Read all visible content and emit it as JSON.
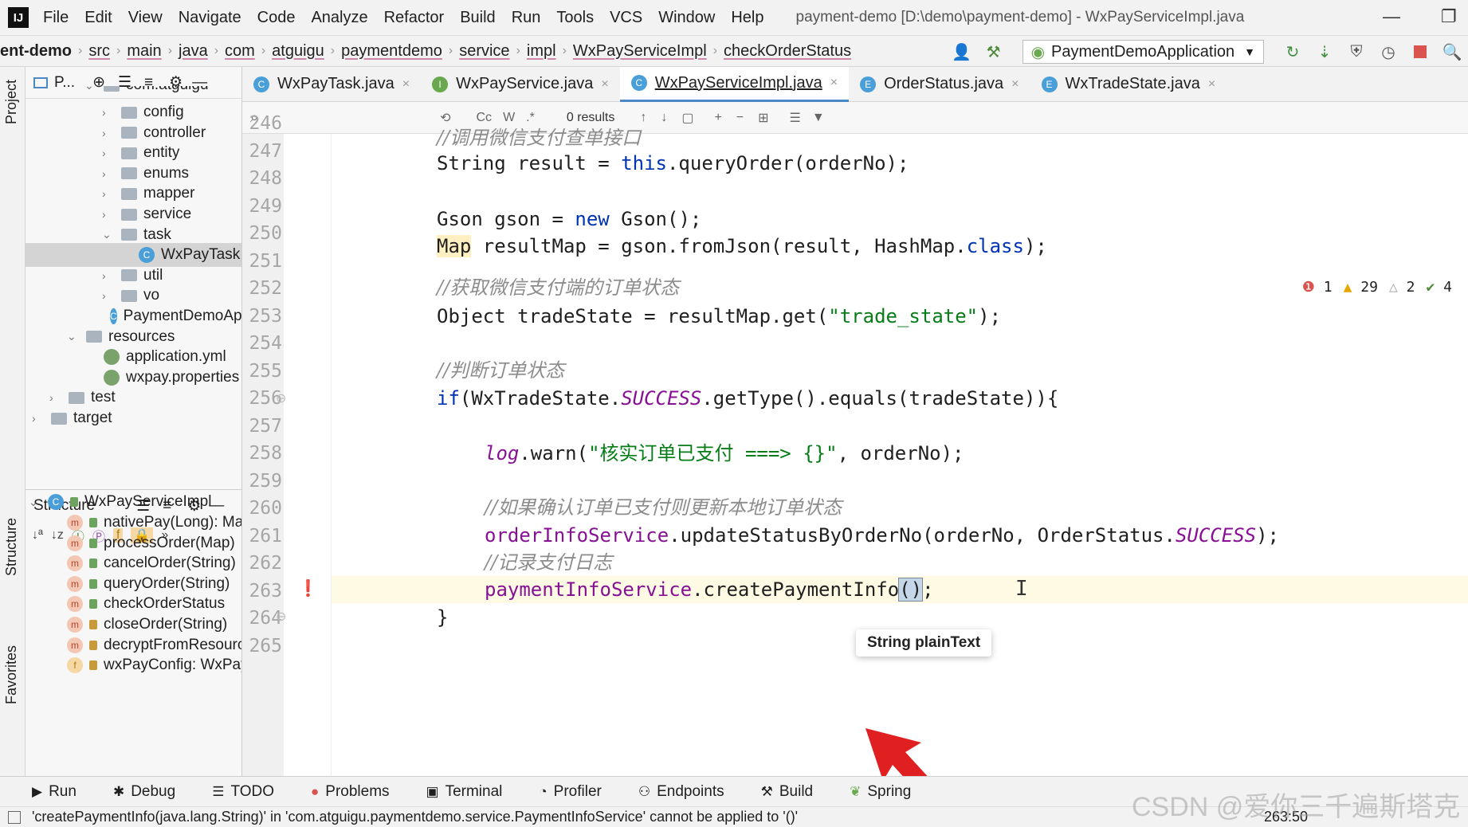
{
  "menubar": {
    "logo": "IJ",
    "items": [
      "File",
      "Edit",
      "View",
      "Navigate",
      "Code",
      "Analyze",
      "Refactor",
      "Build",
      "Run",
      "Tools",
      "VCS",
      "Window",
      "Help"
    ],
    "title": "payment-demo [D:\\demo\\payment-demo] - WxPayServiceImpl.java"
  },
  "breadcrumb": [
    "ent-demo",
    "src",
    "main",
    "java",
    "com",
    "atguigu",
    "paymentdemo",
    "service",
    "impl",
    "WxPayServiceImpl",
    "checkOrderStatus"
  ],
  "run_config": "PaymentDemoApplication",
  "left_strip": {
    "project": "Project",
    "structure": "Structure",
    "favorites": "Favorites"
  },
  "project_panel": {
    "header": "P...",
    "items": [
      {
        "label": "com.atguigu",
        "kind": "package",
        "depth": 3,
        "expanded": true
      },
      {
        "label": "config",
        "kind": "folder",
        "depth": 4,
        "expanded": false
      },
      {
        "label": "controller",
        "kind": "folder",
        "depth": 4,
        "expanded": false
      },
      {
        "label": "entity",
        "kind": "folder",
        "depth": 4,
        "expanded": false
      },
      {
        "label": "enums",
        "kind": "folder",
        "depth": 4,
        "expanded": false
      },
      {
        "label": "mapper",
        "kind": "folder",
        "depth": 4,
        "expanded": false
      },
      {
        "label": "service",
        "kind": "folder",
        "depth": 4,
        "expanded": false
      },
      {
        "label": "task",
        "kind": "folder",
        "depth": 4,
        "expanded": true
      },
      {
        "label": "WxPayTask",
        "kind": "class",
        "depth": 5,
        "selected": true
      },
      {
        "label": "util",
        "kind": "folder",
        "depth": 4,
        "expanded": false
      },
      {
        "label": "vo",
        "kind": "folder",
        "depth": 4,
        "expanded": false
      },
      {
        "label": "PaymentDemoApplication",
        "kind": "class",
        "depth": 4
      },
      {
        "label": "resources",
        "kind": "folder",
        "depth": 2,
        "expanded": true
      },
      {
        "label": "application.yml",
        "kind": "properties",
        "depth": 3
      },
      {
        "label": "wxpay.properties",
        "kind": "properties",
        "depth": 3
      },
      {
        "label": "test",
        "kind": "folder",
        "depth": 1,
        "expanded": false
      },
      {
        "label": "target",
        "kind": "folder",
        "depth": 0,
        "expanded": false
      }
    ]
  },
  "structure_panel": {
    "title": "Structure",
    "root": "WxPayServiceImpl",
    "items": [
      {
        "label": "nativePay(Long): Map",
        "kind": "method",
        "visibility": "public"
      },
      {
        "label": "processOrder(Map)",
        "kind": "method",
        "visibility": "public"
      },
      {
        "label": "cancelOrder(String)",
        "kind": "method",
        "visibility": "public"
      },
      {
        "label": "queryOrder(String)",
        "kind": "method",
        "visibility": "public"
      },
      {
        "label": "checkOrderStatus",
        "kind": "method",
        "visibility": "public"
      },
      {
        "label": "closeOrder(String)",
        "kind": "method",
        "visibility": "private"
      },
      {
        "label": "decryptFromResource",
        "kind": "method",
        "visibility": "private"
      },
      {
        "label": "wxPayConfig: WxPayConfig",
        "kind": "field",
        "visibility": "private"
      }
    ]
  },
  "editor_tabs": [
    {
      "label": "WxPayTask.java",
      "icon": "C",
      "color": "#4a9fd8",
      "active": false
    },
    {
      "label": "WxPayService.java",
      "icon": "I",
      "color": "#6aa84f",
      "active": false
    },
    {
      "label": "WxPayServiceImpl.java",
      "icon": "C",
      "color": "#4a9fd8",
      "active": true
    },
    {
      "label": "OrderStatus.java",
      "icon": "E",
      "color": "#4a9fd8",
      "active": false
    },
    {
      "label": "WxTradeState.java",
      "icon": "E",
      "color": "#4a9fd8",
      "active": false
    }
  ],
  "search": {
    "results": "0 results",
    "case": "Cc",
    "word": "W",
    "regex": ".*"
  },
  "inspections": {
    "errors": "1",
    "warnings": "29",
    "weak": "2",
    "typos": "4"
  },
  "line_numbers": [
    "246",
    "247",
    "248",
    "249",
    "250",
    "251",
    "252",
    "253",
    "254",
    "255",
    "256",
    "257",
    "258",
    "259",
    "260",
    "261",
    "262",
    "263",
    "264",
    "265"
  ],
  "code": {
    "c246": "//调用微信支付查单接口",
    "c247a": "String result = ",
    "c247b": "this",
    "c247c": ".queryOrder(orderNo);",
    "c249a": "Gson gson = ",
    "c249b": "new",
    "c249c": " Gson();",
    "c250a": "Map",
    "c250b": " resultMap = gson.fromJson(result, HashMap.",
    "c250c": "class",
    "c250d": ");",
    "c252": "//获取微信支付端的订单状态",
    "c253a": "Object tradeState = resultMap.get(",
    "c253b": "\"trade_state\"",
    "c253c": ");",
    "c255": "//判断订单状态",
    "c256a": "if",
    "c256b": "(WxTradeState.",
    "c256c": "SUCCESS",
    "c256d": ".getType().equals(tradeState)){",
    "c258a": "log",
    "c258b": ".warn(",
    "c258c": "\"核实订单已支付 ===> {}\"",
    "c258d": ", orderNo);",
    "c260": "//如果确认订单已支付则更新本地订单状态",
    "c261a": "orderInfoService",
    "c261b": ".updateStatusByOrderNo(orderNo, OrderStatus.",
    "c261c": "SUCCESS",
    "c261d": ");",
    "c262": "//记录支付日志",
    "c263a": "paymentInfoService",
    "c263b": ".createPaymentInfo",
    "c263c": "()",
    "c263d": ";",
    "c264": "}"
  },
  "tooltip": "String plainText",
  "bottom_tabs": [
    {
      "label": "Run",
      "icon": "▶"
    },
    {
      "label": "Debug",
      "icon": "✱"
    },
    {
      "label": "TODO",
      "icon": "☰"
    },
    {
      "label": "Problems",
      "icon": "●"
    },
    {
      "label": "Terminal",
      "icon": "▣"
    },
    {
      "label": "Profiler",
      "icon": "◔"
    },
    {
      "label": "Endpoints",
      "icon": "⚇"
    },
    {
      "label": "Build",
      "icon": "⚒"
    },
    {
      "label": "Spring",
      "icon": "❦"
    }
  ],
  "status": {
    "message": "'createPaymentInfo(java.lang.String)' in 'com.atguigu.paymentdemo.service.PaymentInfoService' cannot be applied to '()'",
    "position": "263:50"
  },
  "watermark": "CSDN @爱你三千遍斯塔克",
  "colors": {
    "keyword": "#0033b3",
    "string": "#067d17",
    "comment": "#8c8c8c",
    "static_field": "#871094",
    "accent": "#4a88c7",
    "arrow": "#e02020"
  }
}
